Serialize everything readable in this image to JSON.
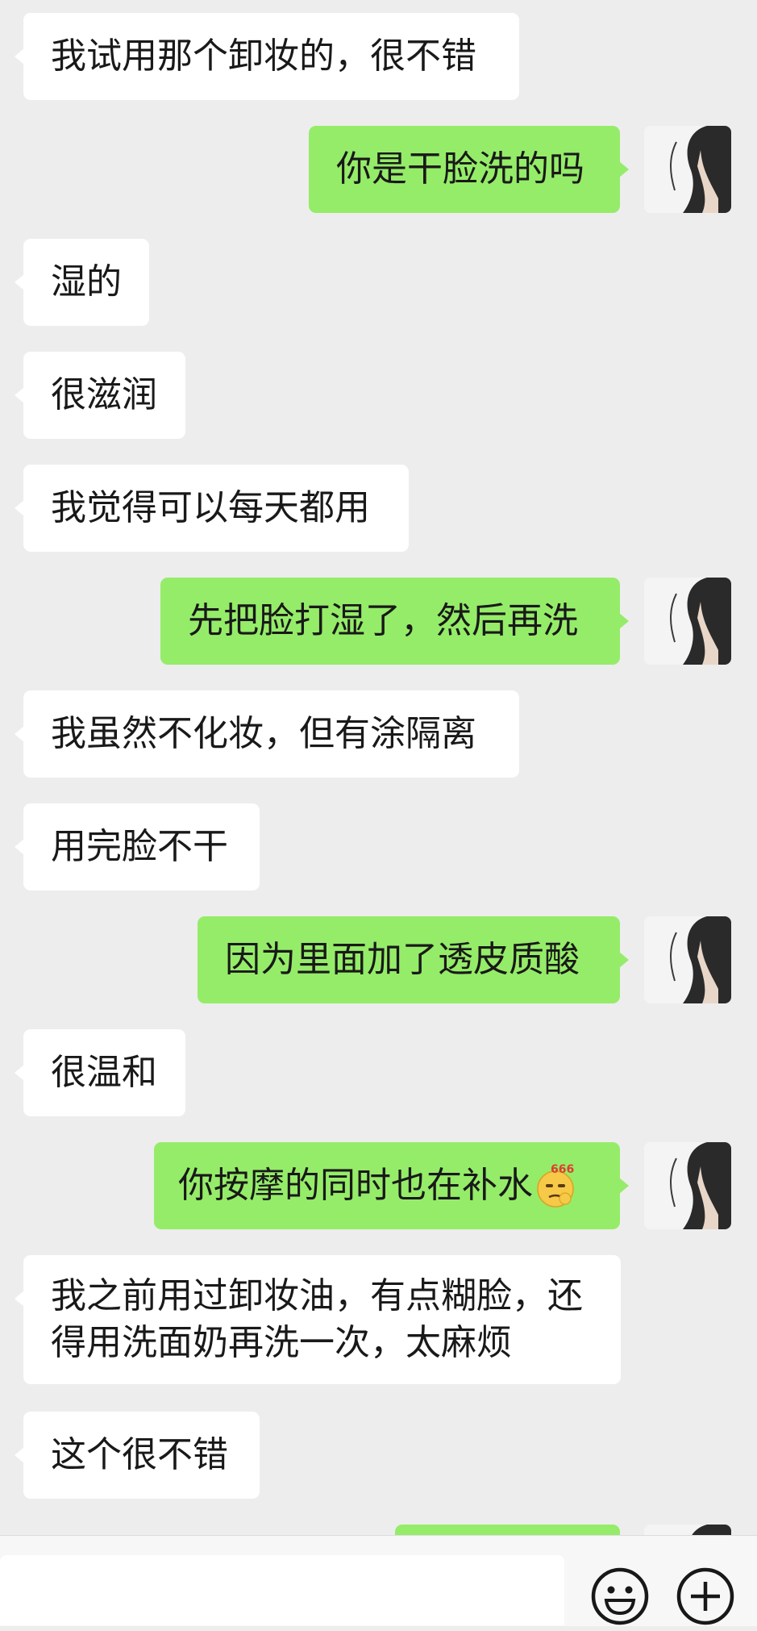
{
  "chat": {
    "messages": [
      {
        "dir": "in",
        "text": "我试用那个卸妆的，很不错"
      },
      {
        "dir": "out",
        "text": "你是干脸洗的吗"
      },
      {
        "dir": "in",
        "text": "湿的"
      },
      {
        "dir": "in",
        "text": "很滋润"
      },
      {
        "dir": "in",
        "text": "我觉得可以每天都用"
      },
      {
        "dir": "out",
        "text": "先把脸打湿了，然后再洗"
      },
      {
        "dir": "in",
        "text": "我虽然不化妆，但有涂隔离"
      },
      {
        "dir": "in",
        "text": "用完脸不干"
      },
      {
        "dir": "out",
        "text": "因为里面加了透皮质酸"
      },
      {
        "dir": "in",
        "text": "很温和"
      },
      {
        "dir": "out",
        "text": "你按摩的同时也在补水",
        "emoji": "666-emoji"
      },
      {
        "dir": "in",
        "text": "我之前用过卸妆油，有点糊脸，还得用洗面奶再洗一次，太麻烦"
      },
      {
        "dir": "in",
        "text": "这个很不错"
      }
    ],
    "emoji_label": "666"
  },
  "input_bar": {
    "emoji_button_icon": "smiley-face-icon",
    "more_button_icon": "plus-circle-icon"
  },
  "colors": {
    "background": "#ededed",
    "incoming_bubble": "#ffffff",
    "outgoing_bubble": "#95ec69",
    "text": "#191919"
  }
}
